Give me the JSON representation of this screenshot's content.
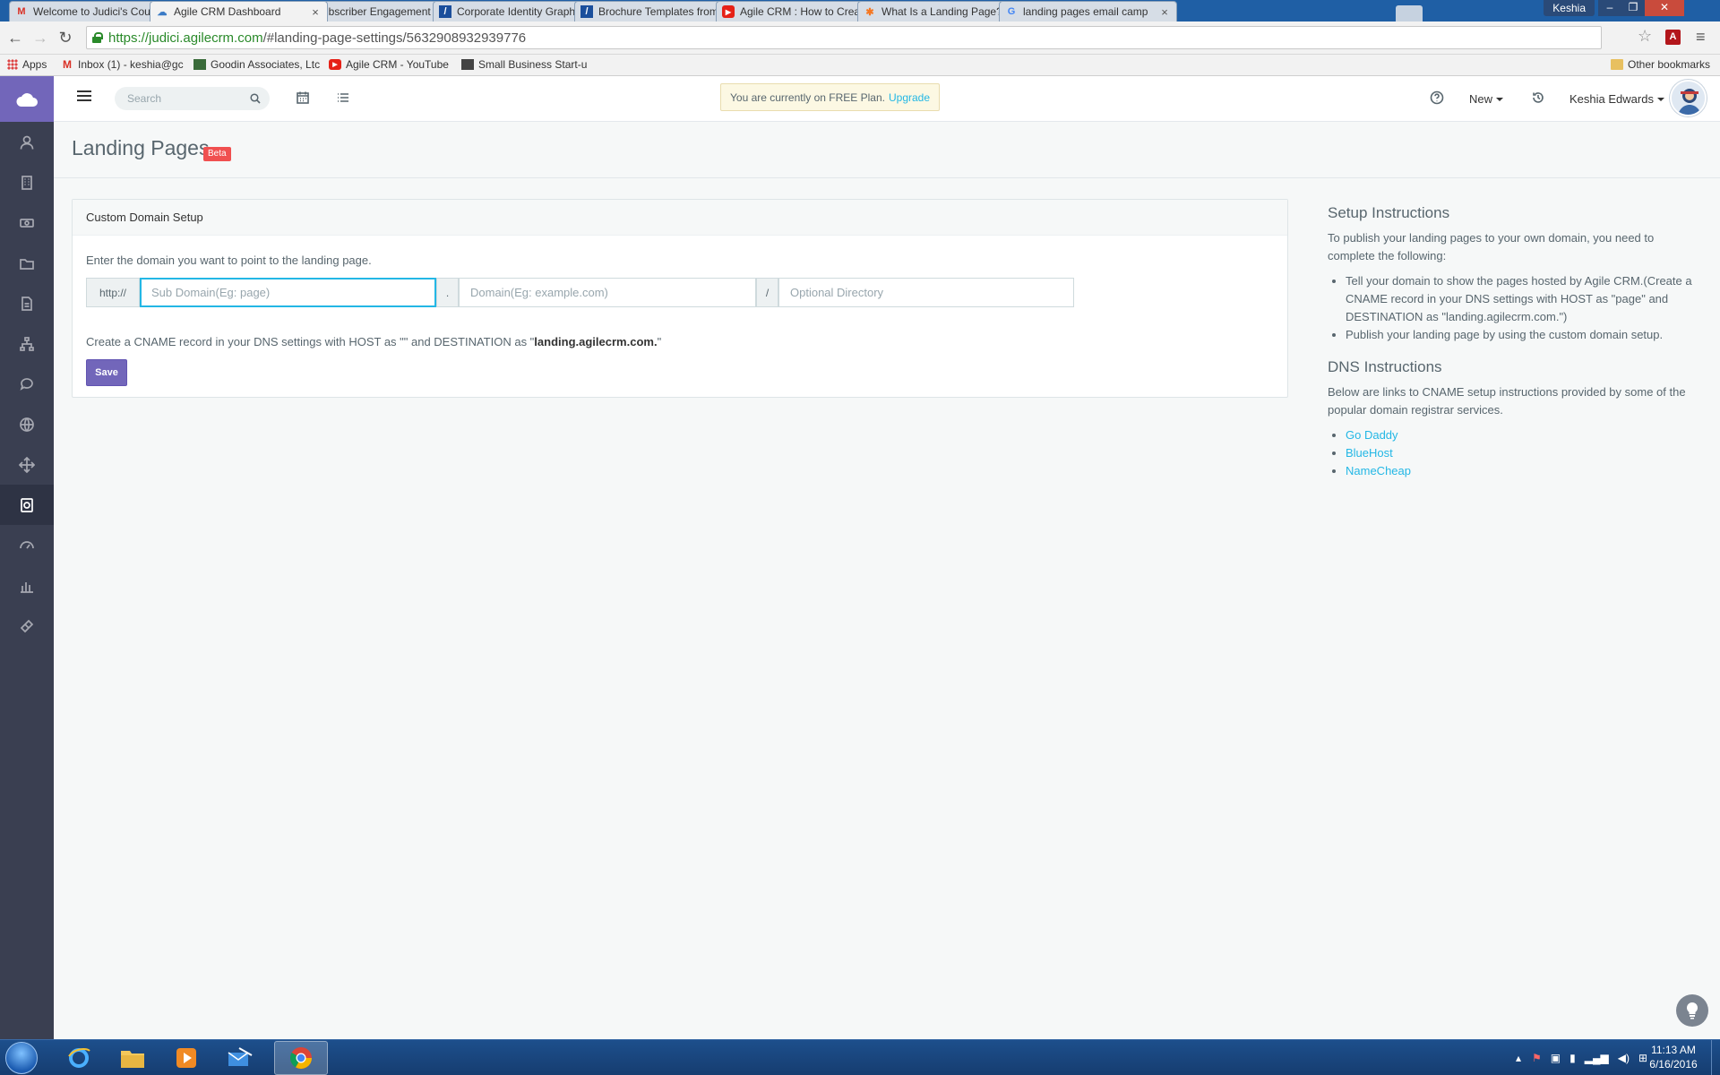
{
  "browser": {
    "tabs": [
      {
        "title": "Welcome to Judici's Cour",
        "favicon": "gmail-icon",
        "active": false
      },
      {
        "title": "Agile CRM Dashboard",
        "favicon": "agile-cloud-icon",
        "active": true
      },
      {
        "title": "Subscriber Engagement T",
        "favicon": "google-docs-icon",
        "active": false
      },
      {
        "title": "Corporate Identity Graphi",
        "favicon": "template-icon",
        "active": false
      },
      {
        "title": "Brochure Templates from",
        "favicon": "template-icon",
        "active": false
      },
      {
        "title": "Agile CRM : How to Creat",
        "favicon": "youtube-icon",
        "active": false
      },
      {
        "title": "What Is a Landing Page? |",
        "favicon": "hubspot-icon",
        "active": false
      },
      {
        "title": "landing pages email camp",
        "favicon": "google-icon",
        "active": false
      }
    ],
    "window_user": "Keshia",
    "url_host": "https://judici.agilecrm.com",
    "url_path": "/#landing-page-settings/5632908932939776",
    "bookmarks": [
      {
        "label": "Apps",
        "icon": "apps-icon"
      },
      {
        "label": "Inbox (1) - keshia@gc",
        "icon": "gmail-icon"
      },
      {
        "label": "Goodin Associates, Ltc",
        "icon": "site-icon"
      },
      {
        "label": "Agile CRM - YouTube",
        "icon": "youtube-icon"
      },
      {
        "label": "Small Business Start-u",
        "icon": "site-icon"
      }
    ],
    "other_bookmarks": "Other bookmarks"
  },
  "topbar": {
    "search_placeholder": "Search",
    "plan_text": "You are currently on FREE Plan.",
    "upgrade_label": "Upgrade",
    "new_label": "New",
    "user_name": "Keshia Edwards"
  },
  "page": {
    "title": "Landing Pages",
    "badge": "Beta"
  },
  "panel": {
    "heading": "Custom Domain Setup",
    "instruction": "Enter the domain you want to point to the landing page.",
    "scheme_prefix": "http://",
    "subdomain_placeholder": "Sub Domain(Eg: page)",
    "dot_separator": ".",
    "domain_placeholder": "Domain(Eg: example.com)",
    "slash_separator": "/",
    "directory_placeholder": "Optional Directory",
    "cname_prefix": "Create a CNAME record in your DNS settings with HOST as \"\" and DESTINATION as \"",
    "cname_destination": "landing.agilecrm.com.",
    "cname_suffix": "\"",
    "save_label": "Save"
  },
  "setup": {
    "heading": "Setup Instructions",
    "intro": "To publish your landing pages to your own domain, you need to complete the following:",
    "steps": [
      "Tell your domain to show the pages hosted by Agile CRM.(Create a CNAME record in your DNS settings with HOST as \"page\" and DESTINATION as \"landing.agilecrm.com.\")",
      "Publish your landing page by using the custom domain setup."
    ]
  },
  "dns": {
    "heading": "DNS Instructions",
    "intro": "Below are links to CNAME setup instructions provided by some of the popular domain registrar services.",
    "links": [
      "Go Daddy",
      "BlueHost",
      "NameCheap"
    ]
  },
  "taskbar": {
    "time": "11:13 AM",
    "date": "6/16/2016"
  },
  "colors": {
    "sidebar": "#3a3f51",
    "brand": "#7266ba",
    "link": "#23b7e5",
    "badge": "#f05050"
  }
}
